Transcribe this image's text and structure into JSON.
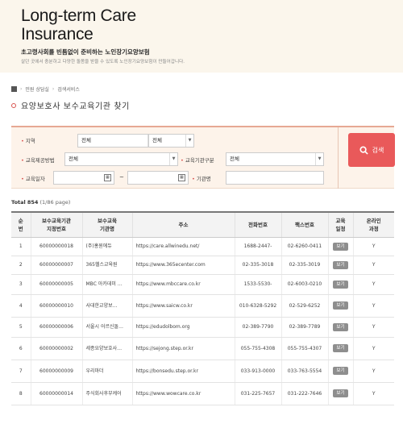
{
  "header": {
    "brand_line1": "Long-term Care",
    "brand_line2": "Insurance",
    "subtitle": "초고령사회를 빈틈없이 준비하는 노인장기요양보험",
    "tagline": "살던 곳에서 충분하고 다양한 돌봄을 받을 수 있도록 노인장기요양보험이 만들어갑니다."
  },
  "breadcrumb": {
    "icon": "home-icon",
    "items": [
      "민원 상담실",
      "검색서비스"
    ]
  },
  "page_title": "요양보호사 보수교육기관 찾기",
  "search": {
    "region_label": "지역",
    "region_value1": "전체",
    "region_value2": "전체",
    "method_label": "교육제공방법",
    "method_value": "전체",
    "type_label": "교육기관구분",
    "type_value": "전체",
    "date_label": "교육일자",
    "date_tilde": "~",
    "name_label": "기관명",
    "button_label": "검색",
    "button_icon": "search-icon",
    "accent_color": "#e9595a"
  },
  "summary": {
    "total_label": "Total",
    "total_count": "854",
    "page_info": "(1/86 page)"
  },
  "table": {
    "headers": {
      "no": [
        "순",
        "번"
      ],
      "code": [
        "보수교육기관",
        "지정번호"
      ],
      "name": [
        "보수교육",
        "기관명"
      ],
      "address": "주소",
      "phone": "전화번호",
      "fax": "팩스번호",
      "schedule": [
        "교육",
        "일정"
      ],
      "online": [
        "온라인",
        "과정"
      ]
    },
    "rows": [
      {
        "no": "1",
        "code": "60000000018",
        "name": "(주)홍원에듀",
        "address": "https://care.allwinedu.net/",
        "phone": "1688-2447-",
        "fax": "02-6260-0411",
        "schedule": "보기",
        "online": "Y"
      },
      {
        "no": "2",
        "code": "60000000007",
        "name": "365헬스교육원",
        "address": "https://www.365ecenter.com",
        "phone": "02-335-3018",
        "fax": "02-335-3019",
        "schedule": "보기",
        "online": "Y"
      },
      {
        "no": "3",
        "code": "60000000005",
        "name": "MBC 아카데미 …",
        "address": "https://www.mbccare.co.kr",
        "phone": "1533-5530-",
        "fax": "02-6003-0210",
        "schedule": "보기",
        "online": "Y"
      },
      {
        "no": "4",
        "code": "60000000010",
        "name": "사대한교양보…",
        "address": "https://www.saicw.co.kr",
        "phone": "010-6328-5292",
        "fax": "02-529-6252",
        "schedule": "보기",
        "online": "Y"
      },
      {
        "no": "5",
        "code": "60000000006",
        "name": "서울시 어르신돌…",
        "address": "https://edudolbom.org",
        "phone": "02-389-7790",
        "fax": "02-389-7789",
        "schedule": "보기",
        "online": "Y"
      },
      {
        "no": "6",
        "code": "60000000002",
        "name": "세종요양보호사…",
        "address": "https://sejong.step.or.kr",
        "phone": "055-755-4308",
        "fax": "055-755-4307",
        "schedule": "보기",
        "online": "Y"
      },
      {
        "no": "7",
        "code": "60000000009",
        "name": "우리마더",
        "address": "https://bonsedu.step.or.kr",
        "phone": "033-913-0000",
        "fax": "033-763-5554",
        "schedule": "보기",
        "online": "Y"
      },
      {
        "no": "8",
        "code": "60000000014",
        "name": "주식회사후부케어",
        "address": "https://www.wowcare.co.kr",
        "phone": "031-225-7657",
        "fax": "031-222-7646",
        "schedule": "보기",
        "online": "Y"
      }
    ]
  }
}
